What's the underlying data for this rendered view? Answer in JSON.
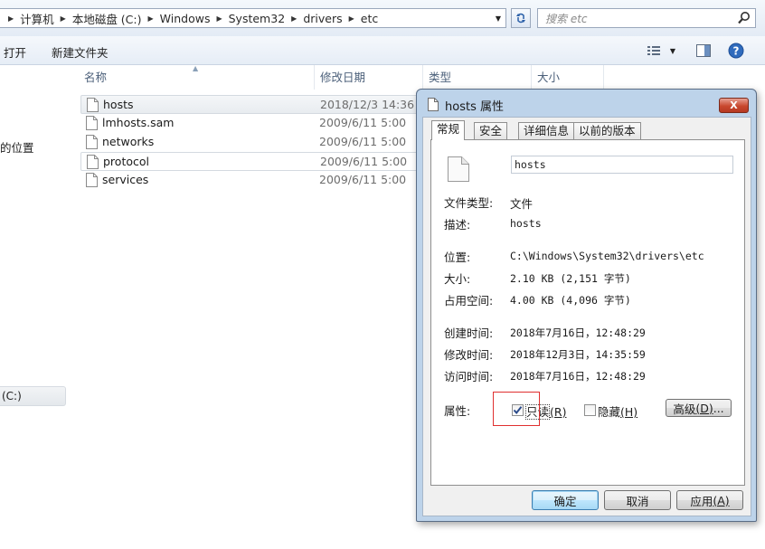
{
  "address": {
    "crumbs": [
      "计算机",
      "本地磁盘 (C:)",
      "Windows",
      "System32",
      "drivers",
      "etc"
    ],
    "search_placeholder": "搜索 etc"
  },
  "toolbar": {
    "open": "打开",
    "new_folder": "新建文件夹"
  },
  "nav": {
    "item_location": "的位置",
    "drive": "(C:)"
  },
  "columns": {
    "name": "名称",
    "modified": "修改日期",
    "type": "类型",
    "size": "大小"
  },
  "files": [
    {
      "name": "hosts",
      "date": "2018/12/3 14:36"
    },
    {
      "name": "lmhosts.sam",
      "date": "2009/6/11 5:00"
    },
    {
      "name": "networks",
      "date": "2009/6/11 5:00"
    },
    {
      "name": "protocol",
      "date": "2009/6/11 5:00"
    },
    {
      "name": "services",
      "date": "2009/6/11 5:00"
    }
  ],
  "dialog": {
    "title": "hosts 属性",
    "close": "X",
    "tabs": [
      "常规",
      "安全",
      "详细信息",
      "以前的版本"
    ],
    "file_name": "hosts",
    "type_label": "文件类型:",
    "type_value": "文件",
    "desc_label": "描述:",
    "desc_value": "hosts",
    "loc_label": "位置:",
    "loc_value": "C:\\Windows\\System32\\drivers\\etc",
    "size_label": "大小:",
    "size_value": "2.10 KB (2,151 字节)",
    "disk_label": "占用空间:",
    "disk_value": "4.00 KB (4,096 字节)",
    "created_label": "创建时间:",
    "created_value": "2018年7月16日，12:48:29",
    "modified_label": "修改时间:",
    "modified_value": "2018年12月3日，14:35:59",
    "accessed_label": "访问时间:",
    "accessed_value": "2018年7月16日，12:48:29",
    "attr_label": "属性:",
    "readonly_text": "只读",
    "readonly_key": "(R)",
    "readonly_checked": true,
    "hidden_text": "隐藏",
    "hidden_key": "(H)",
    "hidden_checked": false,
    "advanced_text": "高级",
    "advanced_key": "(D)",
    "advanced_tail": "...",
    "ok": "确定",
    "cancel": "取消",
    "apply_text": "应用",
    "apply_key": "(A)"
  }
}
